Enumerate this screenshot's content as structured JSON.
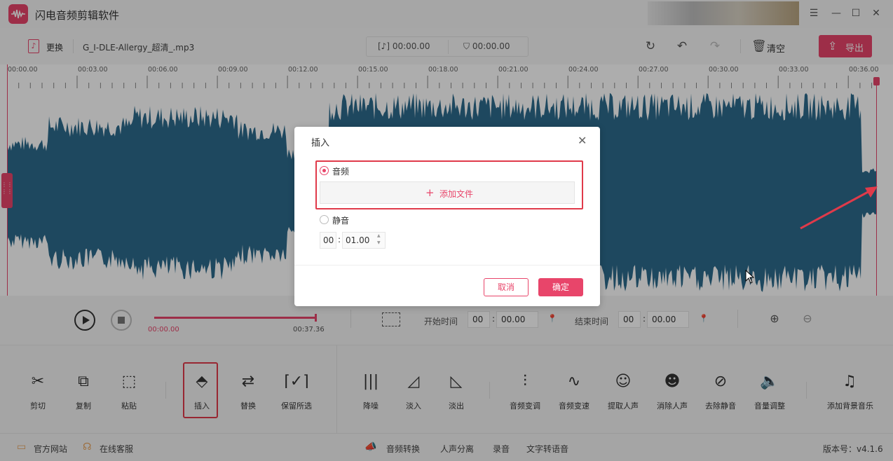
{
  "app": {
    "title": "闪电音频剪辑软件"
  },
  "toolbar": {
    "change_label": "更换",
    "filename": "G_I-DLE-Allergy_超清_.mp3",
    "current_time": "[♪] 00:00.00",
    "selection_time": "00:00.00",
    "clear_label": "清空",
    "export_label": "导出"
  },
  "ruler": {
    "labels": [
      "00:00.00",
      "00:03.00",
      "00:06.00",
      "00:09.00",
      "00:12.00",
      "00:15.00",
      "00:18.00",
      "00:21.00",
      "00:24.00",
      "00:27.00",
      "00:30.00",
      "00:33.00",
      "00:36.00"
    ]
  },
  "waveform": {
    "color": "#2d6a8c",
    "marker_color": "#e8456a"
  },
  "playback": {
    "position_start": "00:00.00",
    "position_end": "00:37.36",
    "start_label": "开始时间",
    "end_label": "结束时间",
    "start_min": "00",
    "start_sec": "00.00",
    "end_min": "00",
    "end_sec": "00.00"
  },
  "tools": {
    "edit": [
      {
        "name": "cut",
        "icon": "scissors-icon",
        "glyph": "✂",
        "label": "剪切"
      },
      {
        "name": "copy",
        "icon": "copy-icon",
        "glyph": "⧉",
        "label": "复制"
      },
      {
        "name": "paste",
        "icon": "paste-icon",
        "glyph": "⬚",
        "label": "粘贴"
      },
      {
        "name": "insert",
        "icon": "insert-icon",
        "glyph": "⬘",
        "label": "插入"
      },
      {
        "name": "replace",
        "icon": "replace-icon",
        "glyph": "⇄",
        "label": "替换"
      },
      {
        "name": "keep-selected",
        "icon": "keep-selection-icon",
        "glyph": "⌈✓⌉",
        "label": "保留所选"
      }
    ],
    "effects": [
      {
        "name": "denoise",
        "icon": "denoise-icon",
        "glyph": "|||",
        "label": "降噪"
      },
      {
        "name": "fade-in",
        "icon": "fade-in-icon",
        "glyph": "◿",
        "label": "淡入"
      },
      {
        "name": "fade-out",
        "icon": "fade-out-icon",
        "glyph": "◺",
        "label": "淡出"
      },
      {
        "name": "pitch-change",
        "icon": "equalizer-icon",
        "glyph": "⫶",
        "label": "音频变调"
      },
      {
        "name": "speed-change",
        "icon": "wave-icon",
        "glyph": "∿",
        "label": "音频变速"
      },
      {
        "name": "extract-vocal",
        "icon": "extract-vocal-icon",
        "glyph": "☺",
        "label": "提取人声"
      },
      {
        "name": "remove-vocal",
        "icon": "remove-vocal-icon",
        "glyph": "☻",
        "label": "消除人声"
      },
      {
        "name": "remove-silence",
        "icon": "remove-silence-icon",
        "glyph": "⊘",
        "label": "去除静音"
      },
      {
        "name": "volume",
        "icon": "volume-icon",
        "glyph": "🔈",
        "label": "音量调整"
      },
      {
        "name": "add-bgm",
        "icon": "music-note-icon",
        "glyph": "♫",
        "label": "添加背景音乐"
      }
    ]
  },
  "statusbar": {
    "website": "官方网站",
    "support": "在线客服",
    "convert": "音频转换",
    "separate": "人声分离",
    "record": "录音",
    "tts": "文字转语音",
    "version": "版本号：v4.1.6"
  },
  "dialog": {
    "title": "插入",
    "option_audio": "音频",
    "add_file": "添加文件",
    "option_silence": "静音",
    "silence_min": "00",
    "silence_sec": "01.00",
    "cancel": "取消",
    "ok": "确定"
  },
  "colors": {
    "accent": "#e8456a",
    "annotation_red": "#e03a4a"
  }
}
